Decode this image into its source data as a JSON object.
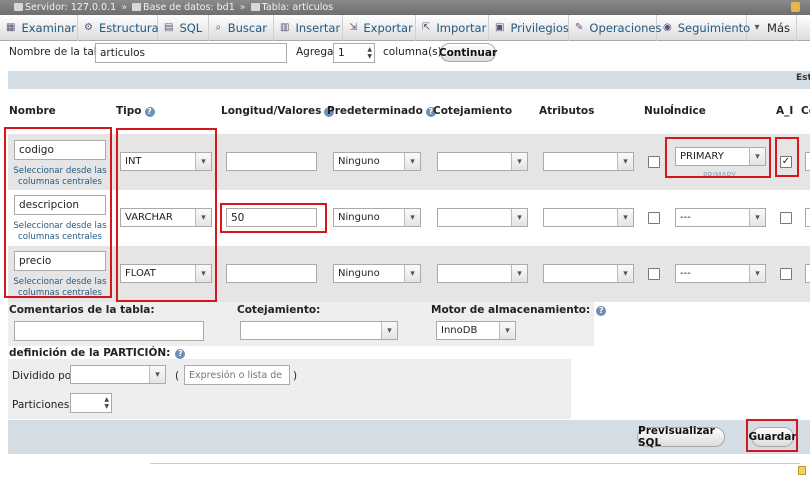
{
  "breadcrumb": {
    "server": "Servidor: 127.0.0.1",
    "database": "Base de datos: bd1",
    "table": "Tabla: articulos",
    "separator": "»"
  },
  "tabs": [
    {
      "label": "Examinar",
      "icon": "browse-icon"
    },
    {
      "label": "Estructura",
      "icon": "structure-icon"
    },
    {
      "label": "SQL",
      "icon": "sql-icon"
    },
    {
      "label": "Buscar",
      "icon": "search-icon"
    },
    {
      "label": "Insertar",
      "icon": "insert-icon"
    },
    {
      "label": "Exportar",
      "icon": "export-icon"
    },
    {
      "label": "Importar",
      "icon": "import-icon"
    },
    {
      "label": "Privilegios",
      "icon": "privileges-icon"
    },
    {
      "label": "Operaciones",
      "icon": "operations-icon"
    },
    {
      "label": "Seguimiento",
      "icon": "tracking-icon"
    },
    {
      "label": "Más",
      "icon": "more-icon"
    }
  ],
  "table_name": {
    "label": "Nombre de la tabla:",
    "value": "articulos",
    "add_label": "Agregar",
    "add_count": "1",
    "columns_label": "columna(s)",
    "continue_button": "Continuar"
  },
  "band_text": "Estr",
  "headers": {
    "name": "Nombre",
    "type": "Tipo",
    "length": "Longitud/Valores",
    "default": "Predeterminado",
    "collation": "Cotejamiento",
    "attributes": "Atributos",
    "null": "Nulo",
    "index": "Índice",
    "ai": "A_I",
    "comments": "Co"
  },
  "central_link": "Seleccionar desde las columnas centrales",
  "index_note": "PRIMARY",
  "rows": [
    {
      "name": "codigo",
      "type": "INT",
      "length": "",
      "default": "Ninguno",
      "collation": "",
      "attributes": "",
      "null": false,
      "index": "PRIMARY",
      "ai": true
    },
    {
      "name": "descripcion",
      "type": "VARCHAR",
      "length": "50",
      "default": "Ninguno",
      "collation": "",
      "attributes": "",
      "null": false,
      "index": "---",
      "ai": false
    },
    {
      "name": "precio",
      "type": "FLOAT",
      "length": "",
      "default": "Ninguno",
      "collation": "",
      "attributes": "",
      "null": false,
      "index": "---",
      "ai": false
    }
  ],
  "table_options": {
    "comments_label": "Comentarios de la tabla:",
    "comments_value": "",
    "collation_label": "Cotejamiento:",
    "collation_value": "",
    "engine_label": "Motor de almacenamiento:",
    "engine_value": "InnoDB"
  },
  "partition": {
    "title": "definición de la PARTICIÓN:",
    "divided_label": "Dividido por:",
    "divided_value": "",
    "open_paren": "(",
    "close_paren": ")",
    "expression_placeholder": "Expresión o lista de colur",
    "partitions_label": "Particiones:",
    "partitions_value": ""
  },
  "actions": {
    "preview_sql": "Previsualizar SQL",
    "save": "Guardar"
  },
  "colors": {
    "accent_red": "#d4171c",
    "link_blue": "#235a81",
    "band": "#d4dce4",
    "row_alt": "#e5e5e5"
  }
}
